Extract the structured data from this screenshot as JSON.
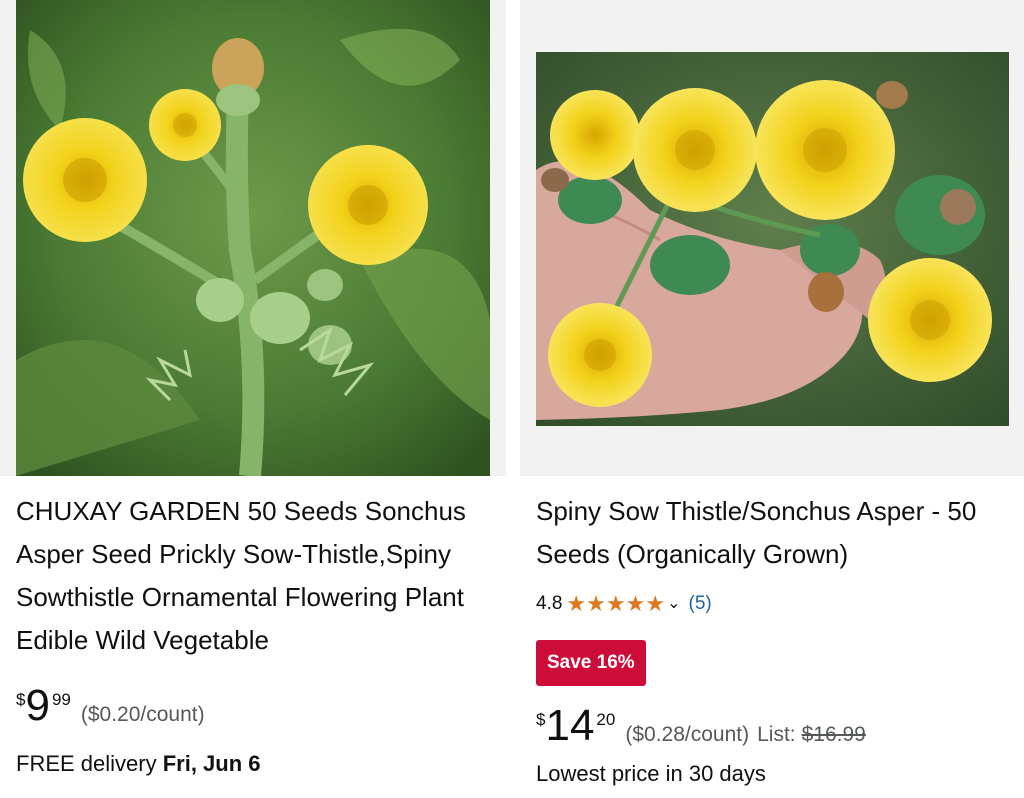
{
  "products": [
    {
      "title": "CHUXAY GARDEN 50 Seeds Sonchus Asper Seed Prickly Sow-Thistle,Spiny Sowthistle Ornamental Flowering Plant Edible Wild Vegetable",
      "price": {
        "symbol": "$",
        "whole": "9",
        "fraction": "99"
      },
      "unit_price": "($0.20/count)",
      "delivery": {
        "prefix": "FREE delivery",
        "date": "Fri, Jun 6"
      },
      "image_alt": "yellow-flower-photo"
    },
    {
      "title": "Spiny Sow Thistle/Sonchus Asper - 50 Seeds (Organically Grown)",
      "rating": {
        "value": "4.8",
        "stars": 5,
        "chevron": "⌄",
        "count": "(5)"
      },
      "badge": "Save 16%",
      "price": {
        "symbol": "$",
        "whole": "14",
        "fraction": "20"
      },
      "unit_price": "($0.28/count)",
      "list_label": "List:",
      "list_price": "$16.99",
      "price_note": "Lowest price in 30 days",
      "image_alt": "yellow-flower-photo"
    }
  ]
}
